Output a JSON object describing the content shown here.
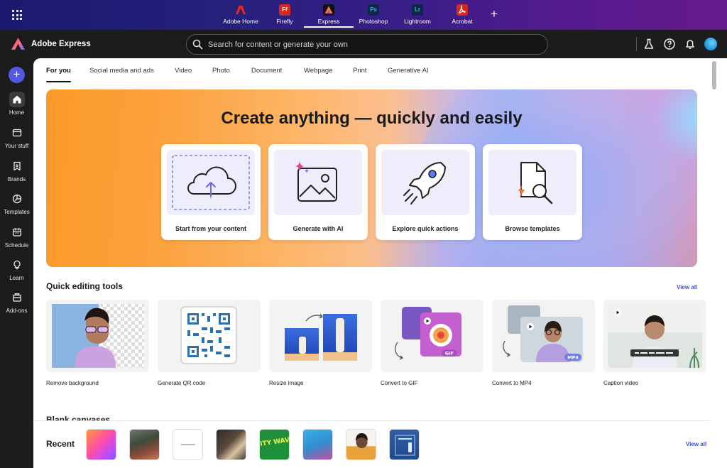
{
  "apps": [
    {
      "name": "Adobe Home",
      "color": "#e8261b",
      "glyph": "A"
    },
    {
      "name": "Firefly",
      "color": "#d8271d",
      "glyph": "Ff"
    },
    {
      "name": "Express",
      "color": "#1e1e1e",
      "glyph": "A",
      "active": true
    },
    {
      "name": "Photoshop",
      "color": "#0f2947",
      "glyph": "Ps"
    },
    {
      "name": "Lightroom",
      "color": "#0f2947",
      "glyph": "Lr"
    },
    {
      "name": "Acrobat",
      "color": "#d8271d",
      "glyph": "A"
    }
  ],
  "header": {
    "brand": "Adobe Express",
    "search_placeholder": "Search for content or generate your own"
  },
  "rail": [
    {
      "label": "Home",
      "icon": "home-icon",
      "active": true
    },
    {
      "label": "Your stuff",
      "icon": "folder-icon"
    },
    {
      "label": "Brands",
      "icon": "brand-icon"
    },
    {
      "label": "Templates",
      "icon": "templates-icon"
    },
    {
      "label": "Schedule",
      "icon": "calendar-icon"
    },
    {
      "label": "Learn",
      "icon": "lightbulb-icon"
    },
    {
      "label": "Add-ons",
      "icon": "addons-icon"
    }
  ],
  "tabs": [
    "For you",
    "Social media and ads",
    "Video",
    "Photo",
    "Document",
    "Webpage",
    "Print",
    "Generative AI"
  ],
  "hero": {
    "title": "Create anything — quickly and easily",
    "cards": [
      {
        "label": "Start from your content",
        "icon": "cloud-upload-icon"
      },
      {
        "label": "Generate with AI",
        "icon": "ai-image-icon"
      },
      {
        "label": "Explore quick actions",
        "icon": "rocket-icon"
      },
      {
        "label": "Browse templates",
        "icon": "template-search-icon"
      }
    ]
  },
  "quick_tools": {
    "title": "Quick editing tools",
    "view_all": "View all",
    "items": [
      "Remove background",
      "Generate QR code",
      "Resize image",
      "Convert to GIF",
      "Convert to MP4",
      "Caption video"
    ],
    "badges": {
      "gif": "GIF",
      "mp4": "MP4"
    }
  },
  "blank_canvases": {
    "title": "Blank canvases"
  },
  "recent": {
    "title": "Recent",
    "view_all": "View all",
    "thumb_text": "CITY WAVE"
  },
  "colors": {
    "accent": "#5258e4",
    "link": "#3a4fcf"
  }
}
